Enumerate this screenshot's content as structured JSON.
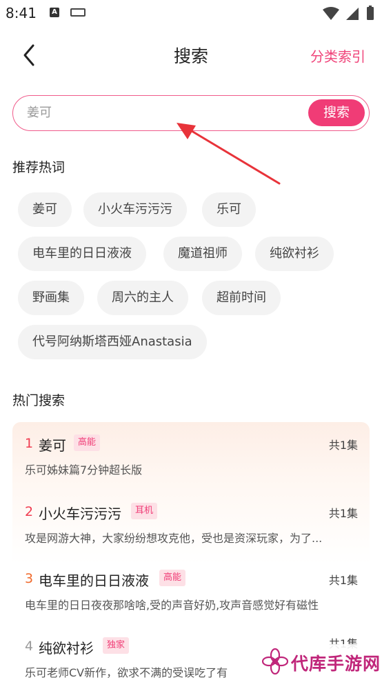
{
  "status_bar": {
    "time": "8:41",
    "a_icon_letter": "A",
    "icons": [
      "a-notification-icon",
      "keyboard-icon",
      "wifi-icon",
      "signal-icon",
      "battery-icon"
    ]
  },
  "nav": {
    "title": "搜索",
    "right_link": "分类索引",
    "back_icon": "back-arrow-icon"
  },
  "search": {
    "placeholder": "姜可",
    "value": "",
    "button_label": "搜索"
  },
  "hot_words": {
    "title": "推荐热词",
    "rows": [
      [
        "姜可",
        "小火车污污污",
        "乐可"
      ],
      [
        "电车里的日日液液",
        "魔道祖师",
        "纯欲衬衫"
      ],
      [
        "野画集",
        "周六的主人",
        "超前时间"
      ],
      [
        "代号阿纳斯塔西娅Anastasia"
      ]
    ]
  },
  "hot_search": {
    "title": "热门搜索",
    "items": [
      {
        "rank": "1",
        "title": "姜可",
        "tag": "高能",
        "episodes": "共1集",
        "desc": "乐可姊妹篇7分钟超长版"
      },
      {
        "rank": "2",
        "title": "小火车污污污",
        "tag": "耳机",
        "episodes": "共1集",
        "desc": "攻是网游大神，大家纷纷想攻克他，受也是资深玩家，为了..."
      },
      {
        "rank": "3",
        "title": "电车里的日日液液",
        "tag": "高能",
        "episodes": "共1集",
        "desc": "电车里的日日夜夜那啥啥,受的声音好奶,攻声音感觉好有磁性"
      },
      {
        "rank": "4",
        "title": "纯欲衬衫",
        "tag": "独家",
        "episodes": "共1集",
        "desc": "乐可老师CV新作，欲求不满的受误吃了有"
      }
    ],
    "rank_colors": [
      "#f03c50",
      "#f03c50",
      "#f06a2c",
      "#999999"
    ]
  },
  "watermark": {
    "text": "代库手游网"
  },
  "colors": {
    "accent": "#f03c76",
    "accent_border": "#f05a8a",
    "tag_bg": "#fde0e6",
    "chip_bg": "#f3f3f3",
    "arrow": "#e8333a"
  }
}
